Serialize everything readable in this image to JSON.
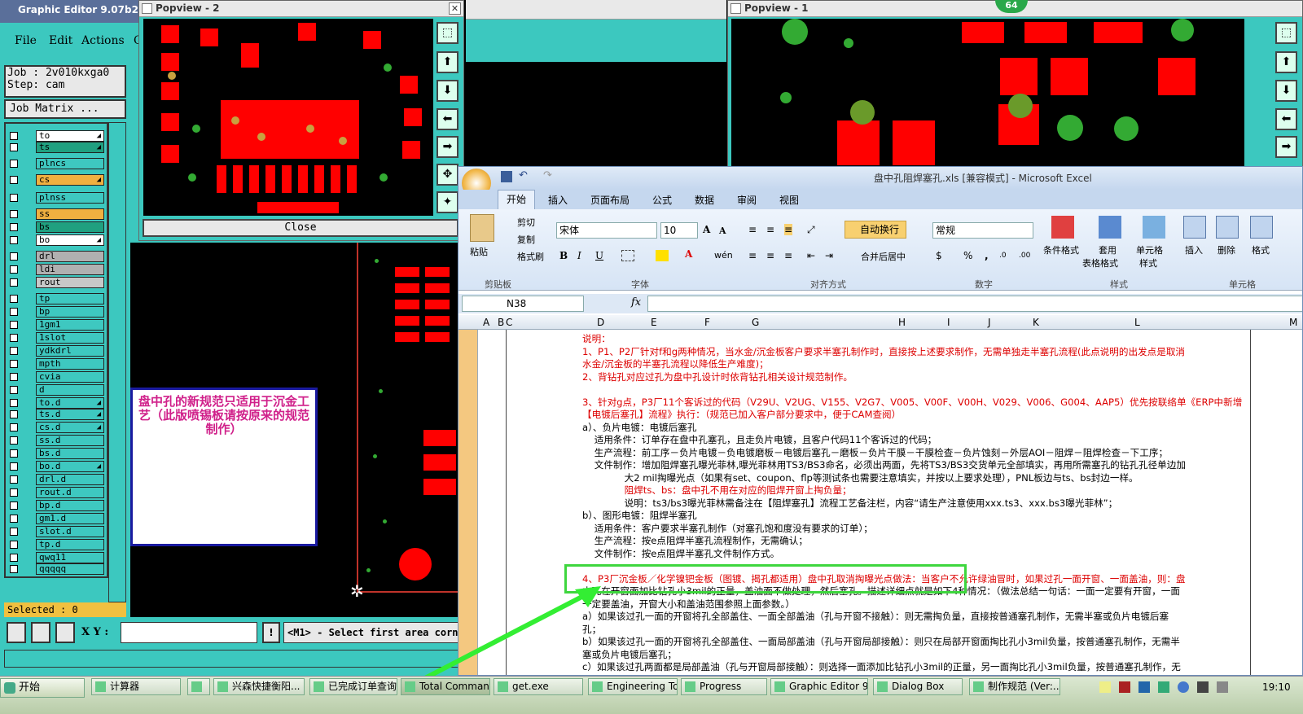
{
  "editor": {
    "title": "Graphic Editor 9.07b2 (00(",
    "menus": [
      "File",
      "Edit",
      "Actions",
      "C"
    ],
    "job": "Job : 2v010kxga0",
    "step": "Step: cam",
    "job_matrix": "Job Matrix ...",
    "layers": [
      {
        "name": "to",
        "color": "#ffffff",
        "arrow": true
      },
      {
        "name": "ts",
        "color": "#20a080",
        "arrow": true
      },
      {
        "name": "plncs",
        "color": "#3ec8c0",
        "arrow": false
      },
      {
        "name": "cs",
        "color": "#f0b040",
        "arrow": true
      },
      {
        "name": "plnss",
        "color": "#3ec8c0",
        "arrow": false
      },
      {
        "name": "ss",
        "color": "#f0b040",
        "arrow": false
      },
      {
        "name": "bs",
        "color": "#20a080",
        "arrow": false
      },
      {
        "name": "bo",
        "color": "#ffffff",
        "arrow": true
      },
      {
        "name": "drl",
        "color": "#b0b0b0",
        "arrow": false
      },
      {
        "name": "ldi",
        "color": "#b0b0b0",
        "arrow": false
      },
      {
        "name": "rout",
        "color": "#c8c8c8",
        "arrow": false
      },
      {
        "name": "tp",
        "color": "#3ec8c0",
        "arrow": false
      },
      {
        "name": "bp",
        "color": "#3ec8c0",
        "arrow": false
      },
      {
        "name": "1gm1",
        "color": "#3ec8c0",
        "arrow": false
      },
      {
        "name": "1slot",
        "color": "#3ec8c0",
        "arrow": false
      },
      {
        "name": "ydkdrl",
        "color": "#3ec8c0",
        "arrow": false
      },
      {
        "name": "mpth",
        "color": "#3ec8c0",
        "arrow": false
      },
      {
        "name": "cvia",
        "color": "#3ec8c0",
        "arrow": false
      },
      {
        "name": "d",
        "color": "#3ec8c0",
        "arrow": false
      },
      {
        "name": "to.d",
        "color": "#3ec8c0",
        "arrow": true
      },
      {
        "name": "ts.d",
        "color": "#3ec8c0",
        "arrow": true
      },
      {
        "name": "cs.d",
        "color": "#3ec8c0",
        "arrow": true
      },
      {
        "name": "ss.d",
        "color": "#3ec8c0",
        "arrow": false
      },
      {
        "name": "bs.d",
        "color": "#3ec8c0",
        "arrow": false
      },
      {
        "name": "bo.d",
        "color": "#3ec8c0",
        "arrow": true
      },
      {
        "name": "drl.d",
        "color": "#3ec8c0",
        "arrow": false
      },
      {
        "name": "rout.d",
        "color": "#3ec8c0",
        "arrow": false
      },
      {
        "name": "bp.d",
        "color": "#3ec8c0",
        "arrow": false
      },
      {
        "name": "gm1.d",
        "color": "#3ec8c0",
        "arrow": false
      },
      {
        "name": "slot.d",
        "color": "#3ec8c0",
        "arrow": false
      },
      {
        "name": "tp.d",
        "color": "#3ec8c0",
        "arrow": false
      },
      {
        "name": "qwq11",
        "color": "#3ec8c0",
        "arrow": false
      },
      {
        "name": "qqqqq",
        "color": "#3ec8c0",
        "arrow": false
      }
    ],
    "selected": "Selected : 0",
    "xy_label": "X Y :",
    "xy_value": "",
    "status": "<M1> - Select first area corner",
    "note": "盘中孔的新规范只适用于沉金工艺（此版喷锡板请按原来的规范制作）"
  },
  "popview2": {
    "title": "Popview - 2",
    "close": "Close"
  },
  "popview1": {
    "title": "Popview - 1"
  },
  "badge": "64",
  "excel": {
    "title": "盘中孔阻焊塞孔.xls  [兼容模式] - Microsoft Excel",
    "tabs": [
      "开始",
      "插入",
      "页面布局",
      "公式",
      "数据",
      "审阅",
      "视图"
    ],
    "clipboard": {
      "paste": "粘贴",
      "cut": "剪切",
      "copy": "复制",
      "format_painter": "格式刷",
      "group": "剪贴板"
    },
    "font": {
      "name": "宋体",
      "size": "10",
      "group": "字体"
    },
    "align": {
      "wrap": "自动换行",
      "merge": "合并后居中",
      "group": "对齐方式"
    },
    "number": {
      "format": "常规",
      "group": "数字"
    },
    "styles": {
      "cond": "条件格式",
      "table1": "套用",
      "table2": "表格格式",
      "cell1": "单元格",
      "cell2": "样式",
      "group": "样式"
    },
    "cells": {
      "insert": "插入",
      "delete": "删除",
      "format": "格式",
      "group": "单元格"
    },
    "namebox": "N38",
    "fx": "fx",
    "columns": [
      "A",
      "B",
      "C",
      "D",
      "E",
      "F",
      "G",
      "H",
      "I",
      "J",
      "K",
      "L",
      "M"
    ],
    "lines": [
      "说明：",
      "1、P1、P2厂针对f和g两种情况，当水金/沉金板客户要求半塞孔制作时，直接按上述要求制作，无需单独走半塞孔流程(此点说明的出发点是取消",
      "水金/沉金板的半塞孔流程以降低生产难度)；",
      "2、背钻孔对应过孔为盘中孔设计时依背钻孔相关设计规范制作。",
      "",
      "3、针对g点，P3厂11个客诉过的代码（V29U、V2UG、V155、V2G7、V005、V00F、V00H、V029、V006、G004、AAP5）优先按联络单《ERP中新增",
      "【电镀后塞孔】流程》执行：（规范已加入客户部分要求中，便于CAM查阅）",
      "a）、负片电镀：电镀后塞孔",
      "    适用条件：订单存在盘中孔塞孔，且走负片电镀，且客户代码11个客诉过的代码；",
      "    生产流程：前工序－负片电镀－负电镀磨板－电镀后塞孔－磨板－负片干膜－干膜检查－负片蚀刻－外层AOI－阻焊－阻焊检查－下工序；",
      "    文件制作：增加阻焊塞孔曝光菲林,曝光菲林用TS3/BS3命名，必须出两面，先将TS3/BS3交货单元全部填实，再用所需塞孔的钻孔孔径单边加",
      "              大2 mil掏曝光点（如果有set、coupon、flp等测试条也需要注意填实，并按以上要求处理），PNL板边与ts、bs封边一样。",
      "              阻焊ts、bs：盘中孔不用在对应的阻焊开窗上掏负量；",
      "              说明：ts3/bs3曝光菲林需备注在【阻焊塞孔】流程工艺备注栏，内容“请生产注意使用xxx.ts3、xxx.bs3曝光菲林”；",
      "b）、图形电镀：阻焊半塞孔",
      "    适用条件：客户要求半塞孔制作（对塞孔饱和度没有要求的订单）；",
      "    生产流程：按e点阻焊半塞孔流程制作，无需确认；",
      "    文件制作：按e点阻焊半塞孔文件制作方式。",
      "",
      "4、P3厂沉金板／化学镍钯金板（图镀、揭孔都适用）盘中孔取消掏曝光点做法：当客户不允许绿油冒时，如果过孔一面开窗、一面盖油，则：盘",
      "中孔在开窗面加比钻孔小3mil的正量，盖油面不做处理，然后塞孔。描述详细点就是如下4种情况：（做法总结一句话：一面一定要有开窗，一面",
      "一定要盖油，开窗大小和盖油范围参照上面参数。）",
      "a）如果该过孔一面的开窗将孔全部盖住、一面全部盖油（孔与开窗不接触）：则无需掏负量，直接按普通塞孔制作，无需半塞或负片电镀后塞",
      "孔；",
      "b）如果该过孔一面的开窗将孔全部盖住、一面局部盖油（孔与开窗局部接触）：则只在局部开窗面掏比孔小3mil负量，按普通塞孔制作，无需半",
      "塞或负片电镀后塞孔；",
      "c）如果该过孔两面都是局部盖油（孔与开窗局部接触）：则选择一面添加比钻孔小3mil的正量，另一面掏比孔小3mil负量，按普通塞孔制作，无"
    ]
  },
  "taskbar": {
    "start": "开始",
    "items": [
      "计算器",
      "",
      "兴森快捷衡阳...",
      "已完成订单查询",
      "Total Command...",
      "get.exe",
      "Engineering To...",
      "Progress",
      "Graphic Editor 9...",
      "Dialog Box",
      "制作规范 (Ver:..."
    ],
    "clock": "19:10"
  }
}
